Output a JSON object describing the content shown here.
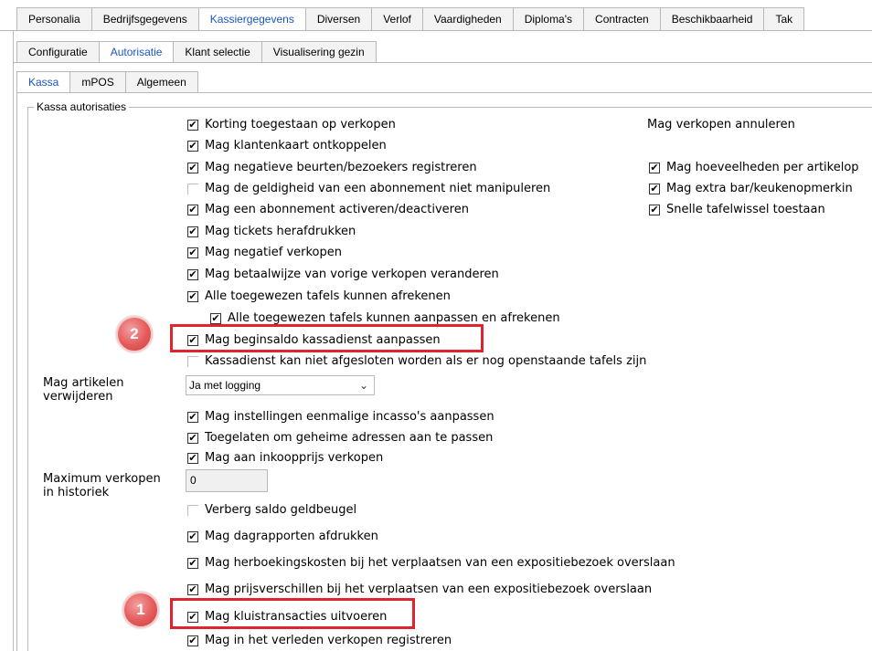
{
  "tabs_main": [
    "Personalia",
    "Bedrijfsgegevens",
    "Kassiergegevens",
    "Diversen",
    "Verlof",
    "Vaardigheden",
    "Diploma's",
    "Contracten",
    "Beschikbaarheid",
    "Tak"
  ],
  "tabs_sub": [
    "Configuratie",
    "Autorisatie",
    "Klant selectie",
    "Visualisering gezin"
  ],
  "tabs_inner": [
    "Kassa",
    "mPOS",
    "Algemeen"
  ],
  "group_label": "Kassa autorisaties",
  "checkboxes": [
    {
      "label": "Korting toegestaan op verkopen",
      "checked": true
    },
    {
      "label": "Mag klantenkaart ontkoppelen",
      "checked": true
    },
    {
      "label": "Mag negatieve beurten/bezoekers registreren",
      "checked": true
    },
    {
      "label": "Mag de geldigheid van een abonnement niet manipuleren",
      "checked": false
    },
    {
      "label": "Mag een abonnement activeren/deactiveren",
      "checked": true
    },
    {
      "label": "Mag tickets herafdrukken",
      "checked": true
    },
    {
      "label": "Mag negatief verkopen",
      "checked": true
    },
    {
      "label": "Mag betaalwijze van vorige verkopen veranderen",
      "checked": true
    },
    {
      "label": "Alle toegewezen tafels kunnen afrekenen",
      "checked": true
    },
    {
      "label": "Alle toegewezen tafels kunnen aanpassen en afrekenen",
      "checked": true
    },
    {
      "label": "Mag beginsaldo kassadienst aanpassen",
      "checked": true
    },
    {
      "label": "Kassadienst kan niet afgesloten worden als er nog openstaande tafels zijn",
      "checked": false
    },
    {
      "label": "Mag instellingen eenmalige incasso's aanpassen",
      "checked": true
    },
    {
      "label": "Toegelaten om geheime adressen aan te passen",
      "checked": true
    },
    {
      "label": "Mag aan inkoopprijs verkopen",
      "checked": true
    },
    {
      "label": "Verberg saldo geldbeugel",
      "checked": false
    },
    {
      "label": "Mag dagrapporten afdrukken",
      "checked": true
    },
    {
      "label": "Mag herboekingskosten bij het verplaatsen van een expositiebezoek overslaan",
      "checked": true
    },
    {
      "label": "Mag prijsverschillen bij het verplaatsen van een expositiebezoek overslaan",
      "checked": true
    },
    {
      "label": "Mag kluistransacties uitvoeren",
      "checked": true
    },
    {
      "label": "Mag in het verleden verkopen registreren",
      "checked": true
    }
  ],
  "right_col": {
    "heading": "Mag verkopen annuleren",
    "checkboxes": [
      {
        "label": "Mag hoeveelheden per artikelop",
        "checked": true
      },
      {
        "label": "Mag extra bar/keukenopmerkin",
        "checked": true
      },
      {
        "label": "Snelle tafelwissel toestaan",
        "checked": true
      }
    ]
  },
  "delete_articles": {
    "label_line1": "Mag artikelen",
    "label_line2": "verwijderen",
    "value": "Ja met logging"
  },
  "max_sales": {
    "label_line1": "Maximum verkopen",
    "label_line2": "in historiek",
    "value": "0"
  },
  "markers": [
    "1",
    "2"
  ],
  "colors": {
    "highlight": "#e0242d",
    "active_tab_text": "#1a56c4"
  }
}
